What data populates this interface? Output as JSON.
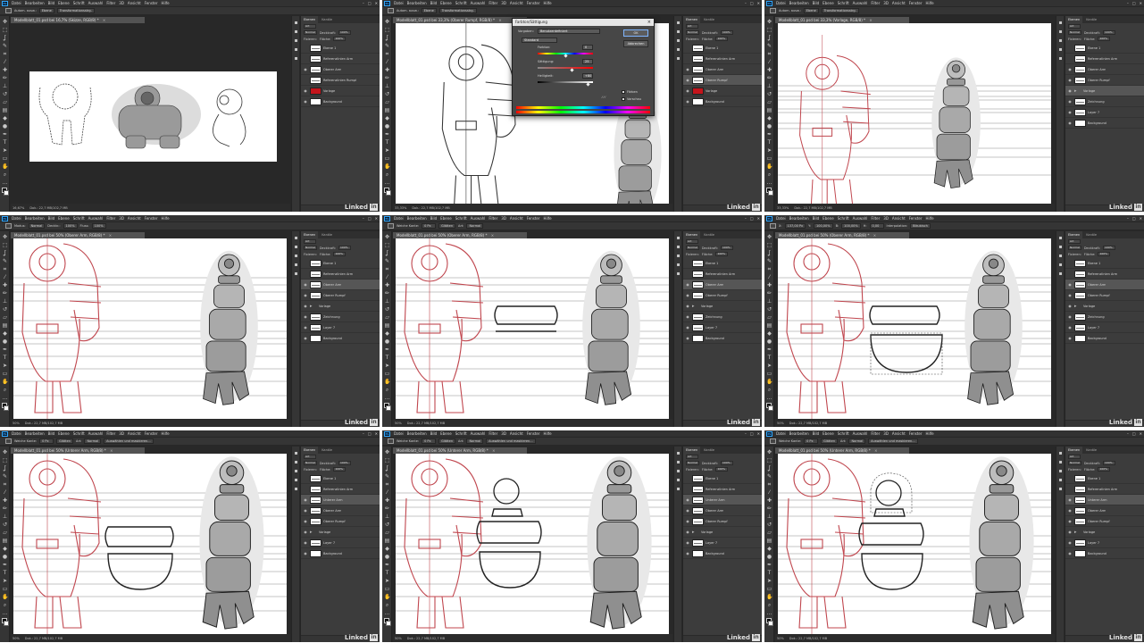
{
  "menu": {
    "logo": "Ps",
    "items": [
      "Datei",
      "Bearbeiten",
      "Bild",
      "Ebene",
      "Schrift",
      "Auswahl",
      "Filter",
      "3D",
      "Ansicht",
      "Fenster",
      "Hilfe"
    ]
  },
  "window_controls": [
    "–",
    "□",
    "✕"
  ],
  "watermark": {
    "text": "Linked",
    "box": "in"
  },
  "panel_tabs": [
    "Ebenen",
    "Kanäle"
  ],
  "panel": {
    "filter_label": "Art",
    "blend_mode": "Normal",
    "opacity_label": "Deckkraft:",
    "opacity_value": "100%",
    "fix_label": "Fixieren:",
    "fill_label": "Fläche:",
    "fill_value": "100%"
  },
  "frames": [
    {
      "options": [
        "Autom. ausw.:",
        "Ebene",
        "Transformationsstrg."
      ],
      "doc_title": "Modellblatt_01.psd bei 16,7% (Skizze, RGB/8) *",
      "status": [
        "16,67%",
        "Dok.: 22,7 MB/102,7 MB"
      ],
      "layers": [
        {
          "name": "Ebene 1",
          "thumb": "lines",
          "eye": false,
          "selected": false
        },
        {
          "name": "Referenzlinien Arm",
          "thumb": "lines",
          "eye": false,
          "selected": false
        },
        {
          "name": "Oberer Arm",
          "thumb": "lines",
          "eye": true,
          "selected": false
        },
        {
          "name": "Referenzlinien Rumpf",
          "thumb": "lines",
          "eye": false,
          "selected": false
        },
        {
          "name": "Vorlage",
          "thumb": "red",
          "eye": true,
          "selected": false
        },
        {
          "name": "Background",
          "thumb": "white",
          "eye": true,
          "selected": false
        }
      ]
    },
    {
      "options": [
        "Autom. ausw.:",
        "Ebene",
        "Transformationsstrg."
      ],
      "doc_title": "Modellblatt_01.psd bei 33,3% (Oberer Rumpf, RGB/8) *",
      "status": [
        "33,33%",
        "Dok.: 22,7 MB/102,7 MB"
      ],
      "layers": [
        {
          "name": "Ebene 1",
          "thumb": "lines",
          "eye": false,
          "selected": false
        },
        {
          "name": "Referenzlinien Arm",
          "thumb": "lines",
          "eye": false,
          "selected": false
        },
        {
          "name": "Oberer Arm",
          "thumb": "lines",
          "eye": true,
          "selected": false
        },
        {
          "name": "Oberer Rumpf",
          "thumb": "lines",
          "eye": true,
          "selected": true
        },
        {
          "name": "Vorlage",
          "thumb": "red",
          "eye": true,
          "selected": false
        },
        {
          "name": "Background",
          "thumb": "white",
          "eye": true,
          "selected": false
        }
      ],
      "dialog": {
        "title": "Farbton/Sättigung",
        "preset_label": "Vorgaben:",
        "preset_value": "Benutzerdefiniert",
        "channel": "Standard",
        "hue_label": "Farbton:",
        "hue_value": "0",
        "sat_label": "Sättigung:",
        "sat_value": "25",
        "light_label": "Helligkeit:",
        "light_value": "+80",
        "ok": "OK",
        "cancel": "Abbrechen",
        "colorize": "Färben",
        "preview": "Vorschau"
      }
    },
    {
      "options": [
        "Autom. ausw.:",
        "Ebene",
        "Transformationsstrg."
      ],
      "doc_title": "Modellblatt_01.psd bei 33,3% (Vorlage, RGB/8) *",
      "status": [
        "33,33%",
        "Dok.: 22,7 MB/102,7 MB"
      ],
      "layers": [
        {
          "name": "Ebene 1",
          "thumb": "lines",
          "eye": false,
          "selected": false
        },
        {
          "name": "Referenzlinien Arm",
          "thumb": "lines",
          "eye": false,
          "selected": false
        },
        {
          "name": "Oberer Arm",
          "thumb": "lines",
          "eye": true,
          "selected": false
        },
        {
          "name": "Oberer Rumpf",
          "thumb": "lines",
          "eye": true,
          "selected": false
        },
        {
          "name": "Vorlage",
          "thumb": "folder",
          "eye": true,
          "selected": true
        },
        {
          "name": "Zeichnung",
          "thumb": "lines",
          "eye": true,
          "selected": false
        },
        {
          "name": "Layer 7",
          "thumb": "lines",
          "eye": true,
          "selected": false
        },
        {
          "name": "Background",
          "thumb": "white",
          "eye": true,
          "selected": false
        }
      ]
    },
    {
      "options": [
        "Modus:",
        "Normal",
        "Deckkr.:",
        "100%",
        "Fluss:",
        "100%"
      ],
      "doc_title": "Modellblatt_01.psd bei 50% (Oberer Arm, RGB/8) *",
      "status": [
        "50%",
        "Dok.: 22,7 MB/102,7 MB"
      ],
      "layers": [
        {
          "name": "Ebene 1",
          "thumb": "lines",
          "eye": false,
          "selected": false
        },
        {
          "name": "Referenzlinien Arm",
          "thumb": "lines",
          "eye": false,
          "selected": false
        },
        {
          "name": "Oberer Arm",
          "thumb": "lines",
          "eye": true,
          "selected": true
        },
        {
          "name": "Oberer Rumpf",
          "thumb": "lines",
          "eye": true,
          "selected": false
        },
        {
          "name": "Vorlage",
          "thumb": "folder",
          "eye": true,
          "selected": false
        },
        {
          "name": "Zeichnung",
          "thumb": "lines",
          "eye": true,
          "selected": false
        },
        {
          "name": "Layer 7",
          "thumb": "lines",
          "eye": true,
          "selected": false
        },
        {
          "name": "Background",
          "thumb": "white",
          "eye": true,
          "selected": false
        }
      ]
    },
    {
      "options": [
        "Weiche Kante:",
        "0 Px",
        "Glätten",
        "Art:",
        "Normal"
      ],
      "doc_title": "Modellblatt_01.psd bei 50% (Oberer Arm, RGB/8) *",
      "status": [
        "50%",
        "Dok.: 22,7 MB/102,7 MB"
      ],
      "layers": [
        {
          "name": "Ebene 1",
          "thumb": "lines",
          "eye": false,
          "selected": false
        },
        {
          "name": "Referenzlinien Arm",
          "thumb": "lines",
          "eye": false,
          "selected": false
        },
        {
          "name": "Oberer Arm",
          "thumb": "lines",
          "eye": true,
          "selected": true
        },
        {
          "name": "Oberer Rumpf",
          "thumb": "lines",
          "eye": true,
          "selected": false
        },
        {
          "name": "Vorlage",
          "thumb": "folder",
          "eye": true,
          "selected": false
        },
        {
          "name": "Zeichnung",
          "thumb": "lines",
          "eye": true,
          "selected": false
        },
        {
          "name": "Layer 7",
          "thumb": "lines",
          "eye": true,
          "selected": false
        },
        {
          "name": "Background",
          "thumb": "white",
          "eye": true,
          "selected": false
        }
      ]
    },
    {
      "options": [
        "X:",
        "137,00 Px",
        "Y:",
        "100,00%",
        "B:",
        "100,00%",
        "H:",
        "0,00",
        "Interpolation:",
        "Bikubisch"
      ],
      "doc_title": "Modellblatt_01.psd bei 50% (Oberer Arm, RGB/8) *",
      "status": [
        "50%",
        "Dok.: 22,7 MB/102,7 MB"
      ],
      "layers": [
        {
          "name": "Ebene 1",
          "thumb": "lines",
          "eye": false,
          "selected": false
        },
        {
          "name": "Referenzlinien Arm",
          "thumb": "lines",
          "eye": false,
          "selected": false
        },
        {
          "name": "Oberer Arm",
          "thumb": "lines",
          "eye": true,
          "selected": true
        },
        {
          "name": "Oberer Rumpf",
          "thumb": "lines",
          "eye": true,
          "selected": false
        },
        {
          "name": "Vorlage",
          "thumb": "folder",
          "eye": true,
          "selected": false
        },
        {
          "name": "Zeichnung",
          "thumb": "lines",
          "eye": true,
          "selected": false
        },
        {
          "name": "Layer 7",
          "thumb": "lines",
          "eye": true,
          "selected": false
        },
        {
          "name": "Background",
          "thumb": "white",
          "eye": true,
          "selected": false
        }
      ]
    },
    {
      "options": [
        "Weiche Kante:",
        "0 Px",
        "Glätten",
        "Art:",
        "Normal",
        "Auswählen und maskieren..."
      ],
      "doc_title": "Modellblatt_01.psd bei 50% (Unterer Arm, RGB/8) *",
      "status": [
        "50%",
        "Dok.: 22,7 MB/102,7 MB"
      ],
      "layers": [
        {
          "name": "Ebene 1",
          "thumb": "lines",
          "eye": false,
          "selected": false
        },
        {
          "name": "Referenzlinien Arm",
          "thumb": "lines",
          "eye": false,
          "selected": false
        },
        {
          "name": "Unterer Arm",
          "thumb": "lines",
          "eye": true,
          "selected": true
        },
        {
          "name": "Oberer Arm",
          "thumb": "lines",
          "eye": true,
          "selected": false
        },
        {
          "name": "Oberer Rumpf",
          "thumb": "lines",
          "eye": true,
          "selected": false
        },
        {
          "name": "Vorlage",
          "thumb": "folder",
          "eye": true,
          "selected": false
        },
        {
          "name": "Layer 7",
          "thumb": "lines",
          "eye": true,
          "selected": false
        },
        {
          "name": "Background",
          "thumb": "white",
          "eye": true,
          "selected": false
        }
      ]
    },
    {
      "options": [
        "Weiche Kante:",
        "0 Px",
        "Glätten",
        "Art:",
        "Normal",
        "Auswählen und maskieren..."
      ],
      "doc_title": "Modellblatt_01.psd bei 50% (Unterer Arm, RGB/8) *",
      "status": [
        "50%",
        "Dok.: 22,7 MB/102,7 MB"
      ],
      "layers": [
        {
          "name": "Ebene 1",
          "thumb": "lines",
          "eye": false,
          "selected": false
        },
        {
          "name": "Referenzlinien Arm",
          "thumb": "lines",
          "eye": false,
          "selected": false
        },
        {
          "name": "Unterer Arm",
          "thumb": "lines",
          "eye": true,
          "selected": true
        },
        {
          "name": "Oberer Arm",
          "thumb": "lines",
          "eye": true,
          "selected": false
        },
        {
          "name": "Oberer Rumpf",
          "thumb": "lines",
          "eye": true,
          "selected": false
        },
        {
          "name": "Vorlage",
          "thumb": "folder",
          "eye": true,
          "selected": false
        },
        {
          "name": "Layer 7",
          "thumb": "lines",
          "eye": true,
          "selected": false
        },
        {
          "name": "Background",
          "thumb": "white",
          "eye": true,
          "selected": false
        }
      ]
    },
    {
      "options": [
        "Weiche Kante:",
        "0 Px",
        "Glätten",
        "Art:",
        "Normal",
        "Auswählen und maskieren..."
      ],
      "doc_title": "Modellblatt_01.psd bei 50% (Unterer Arm, RGB/8) *",
      "status": [
        "50%",
        "Dok.: 22,7 MB/102,7 MB"
      ],
      "layers": [
        {
          "name": "Ebene 1",
          "thumb": "lines",
          "eye": false,
          "selected": false
        },
        {
          "name": "Referenzlinien Arm",
          "thumb": "lines",
          "eye": false,
          "selected": false
        },
        {
          "name": "Unterer Arm",
          "thumb": "lines",
          "eye": true,
          "selected": true
        },
        {
          "name": "Oberer Arm",
          "thumb": "lines",
          "eye": true,
          "selected": false
        },
        {
          "name": "Oberer Rumpf",
          "thumb": "lines",
          "eye": true,
          "selected": false
        },
        {
          "name": "Vorlage",
          "thumb": "folder",
          "eye": true,
          "selected": false
        },
        {
          "name": "Layer 7",
          "thumb": "lines",
          "eye": true,
          "selected": false
        },
        {
          "name": "Background",
          "thumb": "white",
          "eye": true,
          "selected": false
        }
      ]
    }
  ],
  "colors": {
    "ui_dark": "#282828",
    "ui_mid": "#353535",
    "panel": "#3c3c3c",
    "sketch_red": "#c0464e",
    "ink": "#222222",
    "accent_blue": "#31a8ff"
  }
}
